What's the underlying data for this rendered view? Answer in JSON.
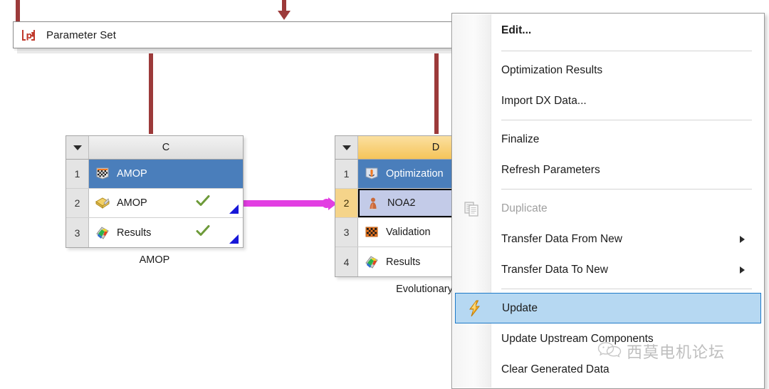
{
  "workspace": {
    "parameter_set": {
      "label": "Parameter Set",
      "icon": "parameter-set-icon"
    },
    "systems": [
      {
        "id": "system-c",
        "column_letter": "C",
        "header_style": "grey",
        "label": "AMOP",
        "rows": [
          {
            "num": "1",
            "text": "AMOP",
            "icon": "checkered-flag-icon",
            "state": "selected-blue",
            "check": false,
            "corner": false
          },
          {
            "num": "2",
            "text": "AMOP",
            "icon": "yellow-sheet-icon",
            "state": "normal",
            "check": true,
            "corner": true
          },
          {
            "num": "3",
            "text": "Results",
            "icon": "results-icon",
            "state": "normal",
            "check": true,
            "corner": true
          }
        ]
      },
      {
        "id": "system-d",
        "column_letter": "D",
        "header_style": "amber",
        "label": "Evolutionary",
        "rows": [
          {
            "num": "1",
            "text": "Optimization",
            "icon": "optimization-icon",
            "state": "selected-blue",
            "check": false,
            "corner": false
          },
          {
            "num": "2",
            "text": "NOA2",
            "icon": "noa2-icon",
            "state": "selected-lavender",
            "check": false,
            "corner": false
          },
          {
            "num": "3",
            "text": "Validation",
            "icon": "checkered-flag-icon",
            "state": "normal",
            "check": false,
            "corner": false
          },
          {
            "num": "4",
            "text": "Results",
            "icon": "results-icon",
            "state": "normal",
            "check": false,
            "corner": false
          }
        ]
      }
    ]
  },
  "context_menu": {
    "items": [
      {
        "label": "Edit...",
        "icon": null,
        "bold": true,
        "disabled": false,
        "selected": false,
        "submenu": false
      },
      {
        "type": "separator"
      },
      {
        "label": "Optimization  Results",
        "icon": null,
        "bold": false,
        "disabled": false,
        "selected": false,
        "submenu": false
      },
      {
        "label": "Import DX Data...",
        "icon": null,
        "bold": false,
        "disabled": false,
        "selected": false,
        "submenu": false
      },
      {
        "type": "separator"
      },
      {
        "label": "Finalize",
        "icon": null,
        "bold": false,
        "disabled": false,
        "selected": false,
        "submenu": false
      },
      {
        "label": "Refresh Parameters",
        "icon": null,
        "bold": false,
        "disabled": false,
        "selected": false,
        "submenu": false
      },
      {
        "type": "separator"
      },
      {
        "label": "Duplicate",
        "icon": "duplicate-icon",
        "bold": false,
        "disabled": true,
        "selected": false,
        "submenu": false
      },
      {
        "label": "Transfer Data From New",
        "icon": null,
        "bold": false,
        "disabled": false,
        "selected": false,
        "submenu": true
      },
      {
        "label": "Transfer Data To New",
        "icon": null,
        "bold": false,
        "disabled": false,
        "selected": false,
        "submenu": true
      },
      {
        "type": "separator"
      },
      {
        "label": "Update",
        "icon": "lightning-icon",
        "bold": false,
        "disabled": false,
        "selected": true,
        "submenu": false
      },
      {
        "label": "Update Upstream Components",
        "icon": null,
        "bold": false,
        "disabled": false,
        "selected": false,
        "submenu": false
      },
      {
        "label": "Clear Generated Data",
        "icon": null,
        "bold": false,
        "disabled": false,
        "selected": false,
        "submenu": false
      }
    ]
  },
  "watermark": {
    "text": "西莫电机论坛",
    "logo": "wechat-icon"
  },
  "colors": {
    "connector_red": "#9c3a3a",
    "connector_magenta": "#e23ee2",
    "row_select_blue": "#4a7ebb",
    "row_select_lavender": "#c3cbe8",
    "header_amber": "#f5c45a",
    "menu_highlight": "#b6d8f2",
    "menu_highlight_border": "#1e7ac8",
    "check_green": "#6d9a39",
    "corner_blue": "#1717d8"
  }
}
